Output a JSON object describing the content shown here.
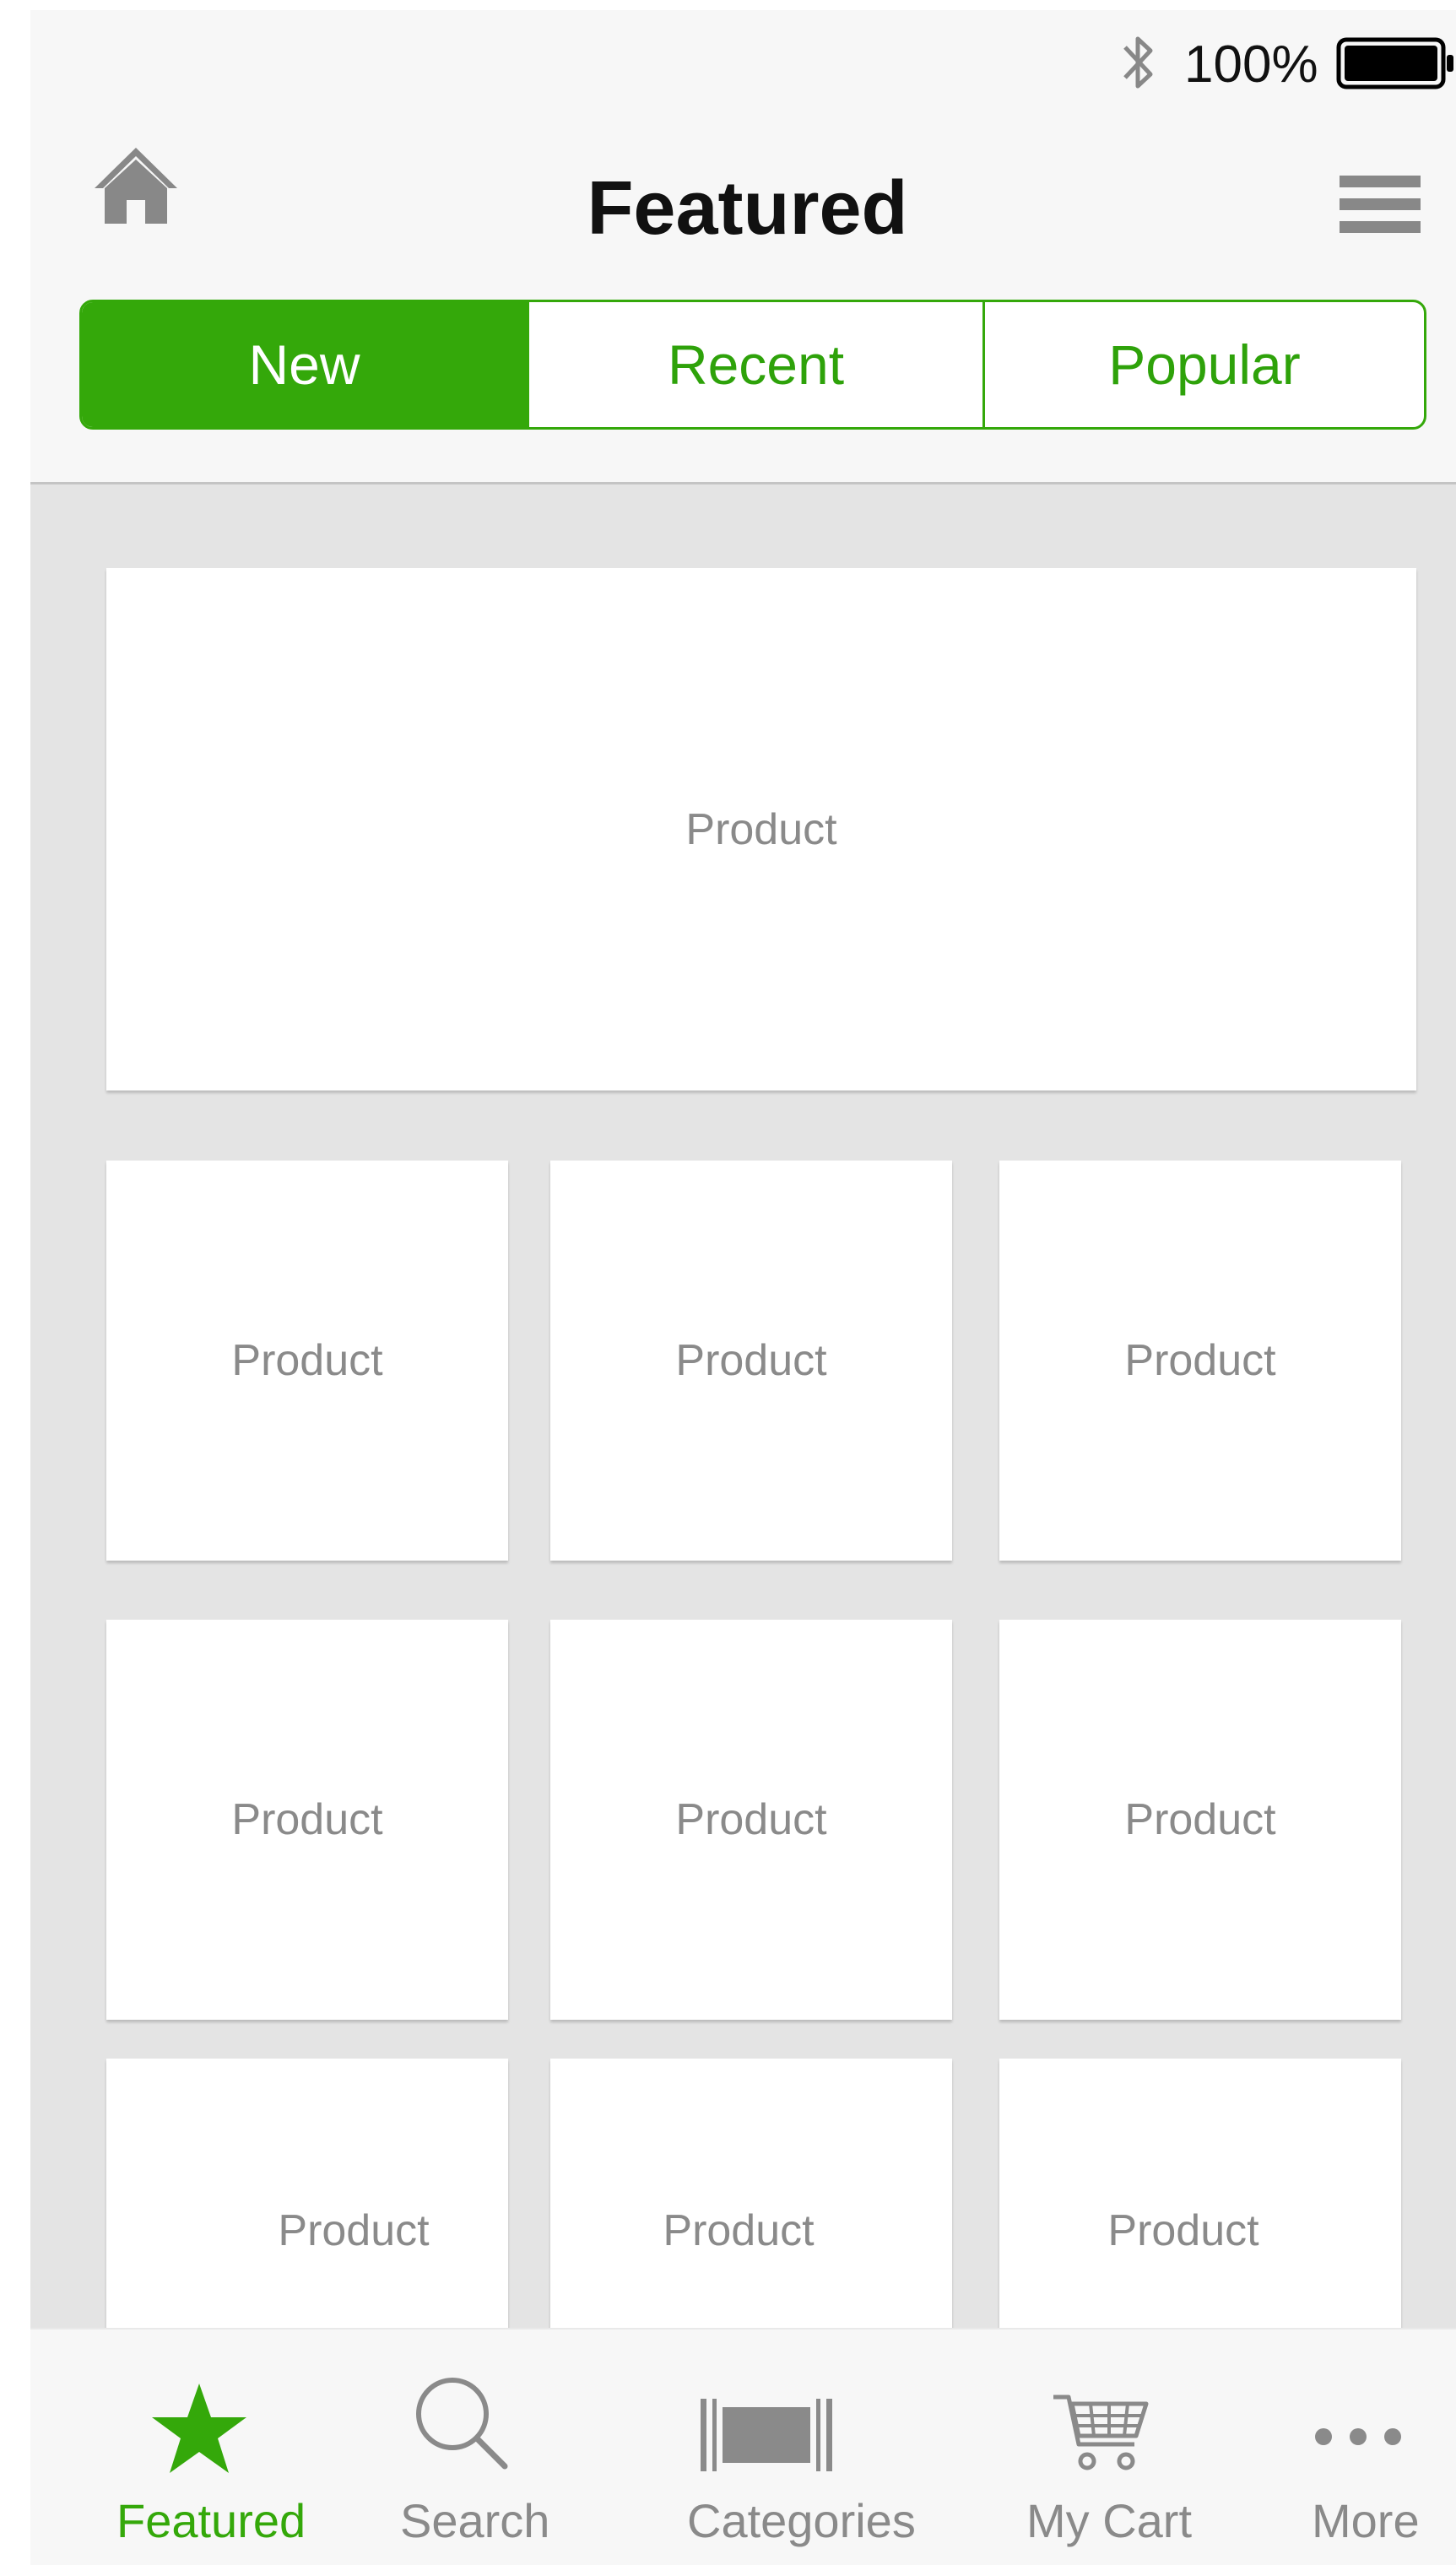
{
  "status_bar": {
    "battery_percent": "100%",
    "icons": [
      "bluetooth-icon",
      "battery-icon"
    ]
  },
  "header": {
    "title": "Featured",
    "left_icon": "home-icon",
    "right_icon": "menu-icon"
  },
  "segments": [
    {
      "label": "New",
      "active": true
    },
    {
      "label": "Recent",
      "active": false
    },
    {
      "label": "Popular",
      "active": false
    }
  ],
  "products": {
    "hero_label": "Product",
    "grid_labels": [
      "Product",
      "Product",
      "Product",
      "Product",
      "Product",
      "Product",
      "Product",
      "Product",
      "Product"
    ]
  },
  "tab_bar": {
    "items": [
      {
        "label": "Featured",
        "icon": "star-icon",
        "active": true
      },
      {
        "label": "Search",
        "icon": "search-icon",
        "active": false
      },
      {
        "label": "Categories",
        "icon": "barcode-icon",
        "active": false
      },
      {
        "label": "My Cart",
        "icon": "cart-icon",
        "active": false
      },
      {
        "label": "More",
        "icon": "more-icon",
        "active": false
      }
    ]
  },
  "colors": {
    "accent": "#34a80a",
    "tile_text": "#8a8a8a",
    "background": "#e4e4e4",
    "bar_background": "#f7f7f7"
  }
}
